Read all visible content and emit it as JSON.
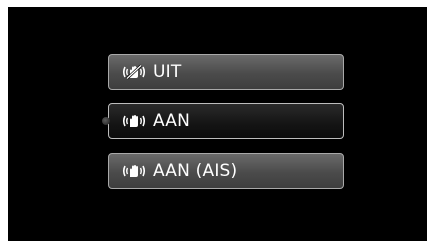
{
  "menu": {
    "options": [
      {
        "label": "UIT",
        "icon": "hand-stabilizer-off-icon",
        "selected": false
      },
      {
        "label": "AAN",
        "icon": "hand-stabilizer-on-icon",
        "selected": true
      },
      {
        "label": "AAN (AIS)",
        "icon": "hand-stabilizer-ais-icon",
        "selected": false
      }
    ]
  },
  "colors": {
    "screen_background": "#000000",
    "button_normal": "#4b4b4b",
    "button_selected": "#141414",
    "button_border": "#a9a9a9",
    "text": "#ffffff"
  }
}
